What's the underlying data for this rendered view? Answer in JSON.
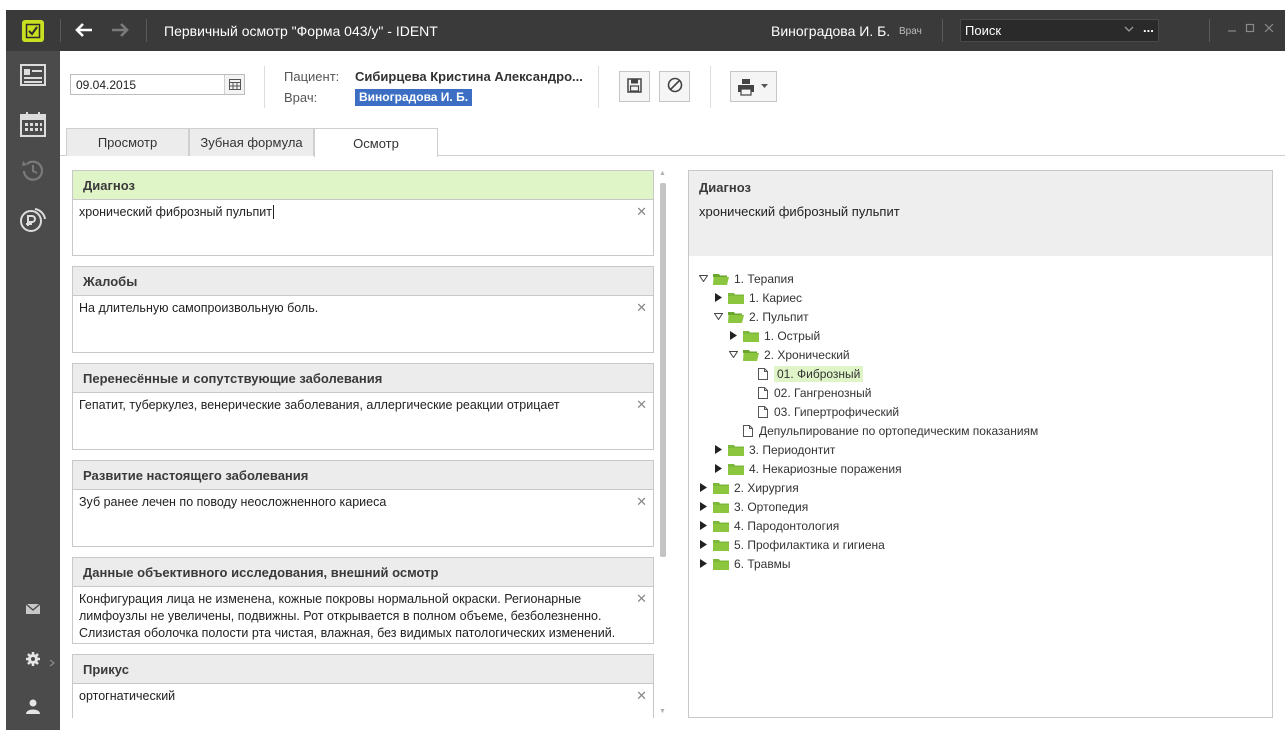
{
  "titlebar": {
    "title": "Первичный осмотр \"Форма 043/у\"  -  IDENT",
    "user_name": "Виноградова И. Б.",
    "user_role": "Врач",
    "search_placeholder": "Поиск",
    "search_more": "..."
  },
  "header": {
    "date_value": "09.04.2015",
    "patient_label": "Пациент:",
    "patient_name": "Сибирцева Кристина Александро...",
    "doctor_label": "Врач:",
    "doctor_name": "Виноградова И. Б."
  },
  "tabs": [
    {
      "label": "Просмотр"
    },
    {
      "label": "Зубная формула"
    },
    {
      "label": "Осмотр"
    }
  ],
  "sections": [
    {
      "title": "Диагноз",
      "text": "хронический фиброзный пульпит"
    },
    {
      "title": "Жалобы",
      "text": "На длительную самопроизвольную боль."
    },
    {
      "title": "Перенесённые и сопутствующие заболевания",
      "text": "Гепатит, туберкулез, венерические заболевания, аллергические реакции отрицает"
    },
    {
      "title": "Развитие настоящего заболевания",
      "text": "Зуб ранее лечен по поводу неосложненного кариеса"
    },
    {
      "title": "Данные объективного исследования, внешний осмотр",
      "text": "Конфигурация лица не изменена, кожные покровы нормальной окраски. Регионарные лимфоузлы не увеличены, подвижны. Рот открывается в полном объеме, безболезненно. Слизистая оболочка полости рта чистая, влажная, без видимых патологических изменений."
    },
    {
      "title": "Прикус",
      "text": "ортогнатический"
    }
  ],
  "right_panel": {
    "title": "Диагноз",
    "text": "хронический фиброзный пульпит",
    "tree": [
      {
        "label": "1. Терапия"
      },
      {
        "label": "1. Кариес"
      },
      {
        "label": "2. Пульпит"
      },
      {
        "label": "1. Острый"
      },
      {
        "label": "2. Хронический"
      },
      {
        "label": "01. Фиброзный"
      },
      {
        "label": "02. Гангренозный"
      },
      {
        "label": "03. Гипертрофический"
      },
      {
        "label": "Депульпирование по ортопедическим показаниям"
      },
      {
        "label": "3. Периодонтит"
      },
      {
        "label": "4. Некариозные поражения"
      },
      {
        "label": "2. Хирургия"
      },
      {
        "label": "3. Ортопедия"
      },
      {
        "label": "4. Пародонтология"
      },
      {
        "label": "5. Профилактика и гигиена"
      },
      {
        "label": "6. Травмы"
      }
    ]
  },
  "icons": {
    "logo": "checkmark-logo-icon",
    "back": "arrow-left-icon",
    "forward": "arrow-right-icon",
    "save": "floppy-disk-icon",
    "cancel": "cancel-icon",
    "print": "printer-icon"
  },
  "colors": {
    "titlebar": "#3a3a3a",
    "sidebar": "#4b4b4b",
    "logo_accent": "#c8e020",
    "highlight": "#dff5c8",
    "doctor_tag": "#3c6fc4",
    "folder": "#8cc63f"
  }
}
